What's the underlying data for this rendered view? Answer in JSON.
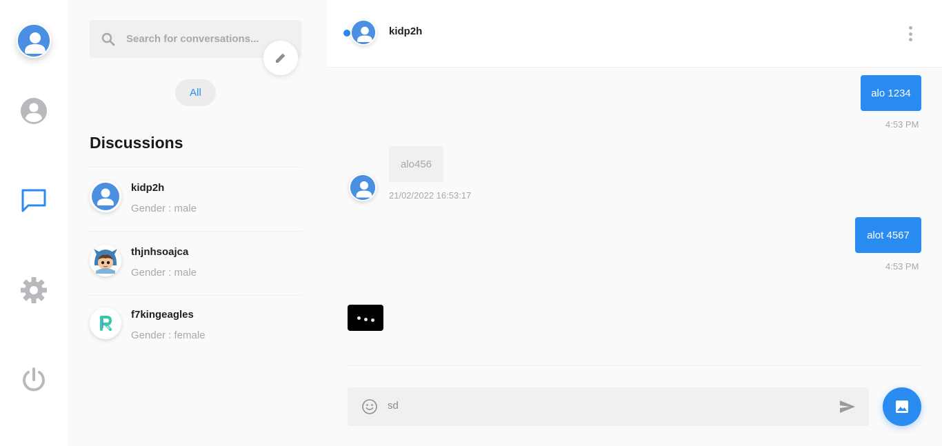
{
  "rail": {
    "items": [
      {
        "name": "profile",
        "icon": "user-avatar-icon"
      },
      {
        "name": "contacts",
        "icon": "user-circle-icon"
      },
      {
        "name": "chats",
        "icon": "chat-bubble-icon",
        "active": true
      },
      {
        "name": "settings",
        "icon": "gear-icon"
      },
      {
        "name": "logout",
        "icon": "power-icon"
      }
    ]
  },
  "list": {
    "search_placeholder": "Search for conversations...",
    "filter_all": "All",
    "section_title": "Discussions",
    "conversations": [
      {
        "name": "kidp2h",
        "subtitle": "Gender : male",
        "avatar": "default-user"
      },
      {
        "name": "thjnhsoajca",
        "subtitle": "Gender : male",
        "avatar": "cartoon-character"
      },
      {
        "name": "f7kingeagles",
        "subtitle": "Gender : female",
        "avatar": "letter-r-logo"
      }
    ]
  },
  "chat": {
    "contact_name": "kidp2h",
    "online": true,
    "messages": [
      {
        "direction": "out",
        "text": "alo 1234",
        "time": "4:53 PM"
      },
      {
        "direction": "in",
        "text": "alo456",
        "time": "21/02/2022 16:53:17"
      },
      {
        "direction": "out",
        "text": "alot 4567",
        "time": "4:53 PM"
      }
    ],
    "typing_indicator": true,
    "composer_value": "sd"
  },
  "colors": {
    "accent": "#2a8bf0",
    "avatar_blue": "#4b8fe2",
    "muted_text": "#a8a8a8",
    "panel_bg": "#fafafa"
  }
}
